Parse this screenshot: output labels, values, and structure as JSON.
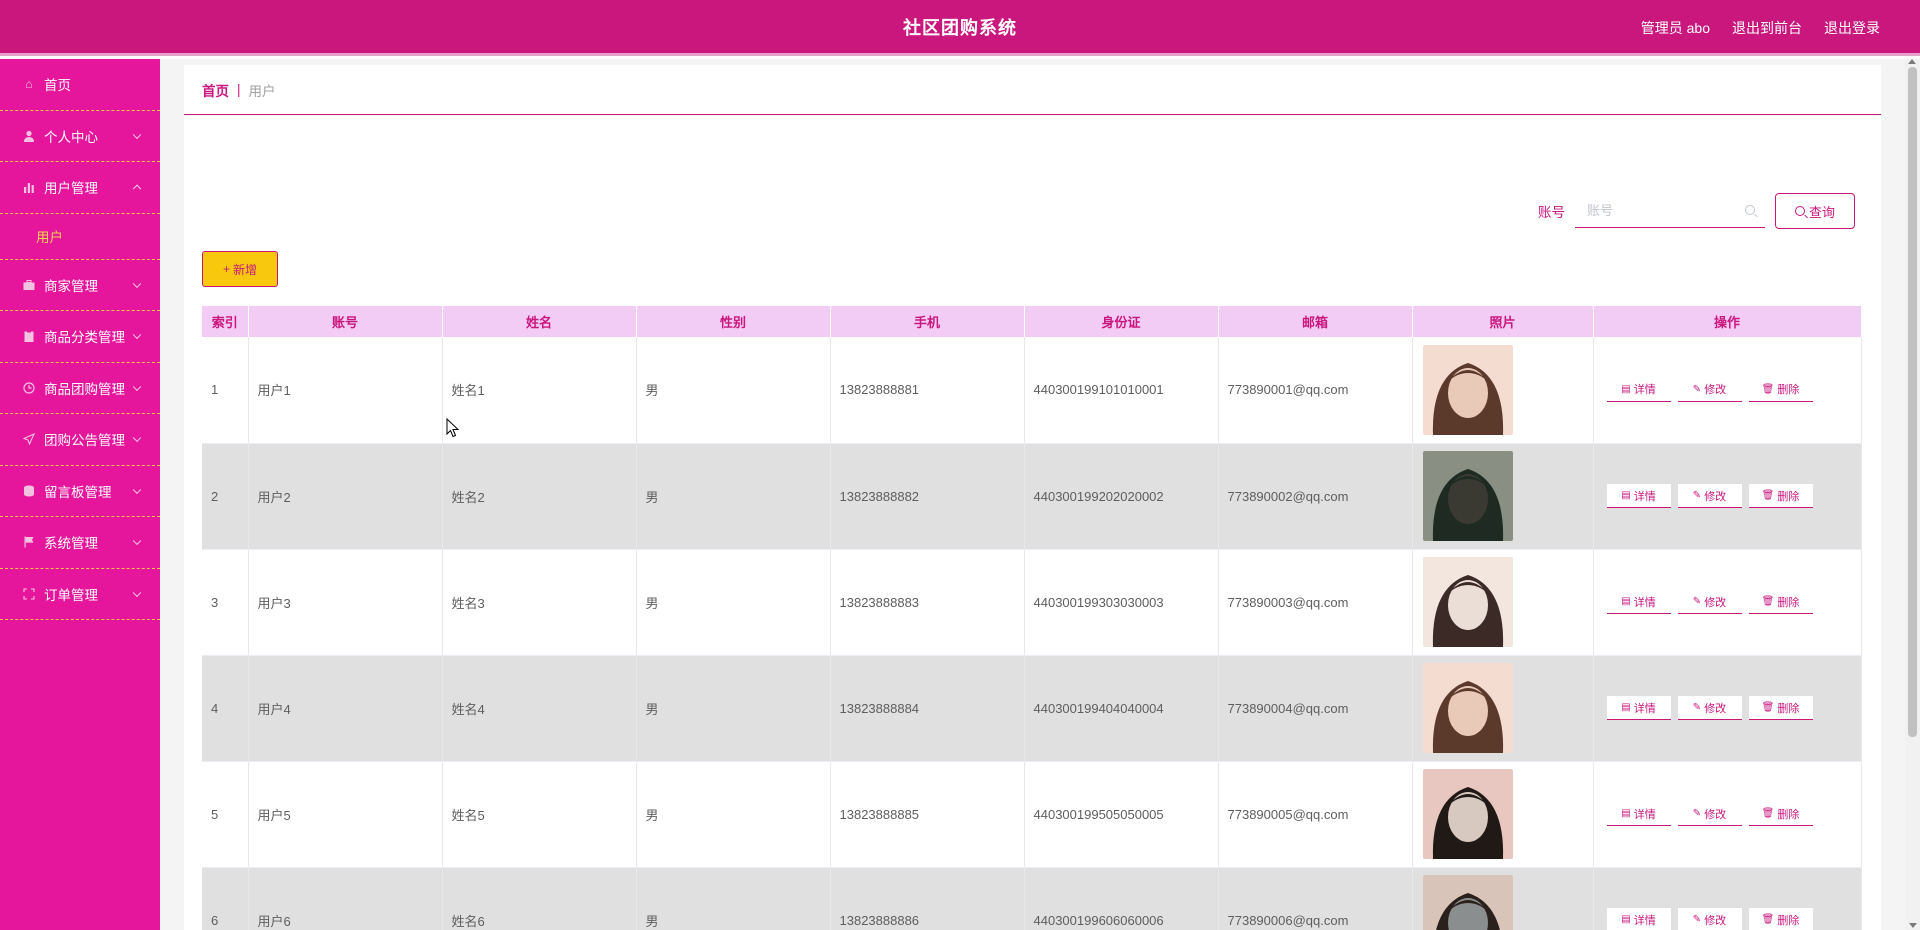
{
  "header": {
    "title": "社区团购系统",
    "admin": "管理员 abo",
    "to_front": "退出到前台",
    "logout": "退出登录"
  },
  "sidebar": {
    "items": [
      {
        "label": "首页",
        "icon": "home-icon"
      },
      {
        "label": "个人中心",
        "icon": "user-icon"
      },
      {
        "label": "用户管理",
        "icon": "chart-icon",
        "expanded": true
      },
      {
        "label": "商家管理",
        "icon": "briefcase-icon"
      },
      {
        "label": "商品分类管理",
        "icon": "clipboard-icon"
      },
      {
        "label": "商品团购管理",
        "icon": "clock-icon"
      },
      {
        "label": "团购公告管理",
        "icon": "send-icon"
      },
      {
        "label": "留言板管理",
        "icon": "database-icon"
      },
      {
        "label": "系统管理",
        "icon": "flag-icon"
      },
      {
        "label": "订单管理",
        "icon": "crop-icon"
      }
    ],
    "sub_active": "用户"
  },
  "breadcrumb": {
    "home": "首页",
    "separator": "|",
    "current": "用户"
  },
  "search": {
    "label": "账号",
    "placeholder": "账号",
    "query_label": "查询"
  },
  "actions": {
    "add_label": "新增"
  },
  "table": {
    "columns": [
      "索引",
      "账号",
      "姓名",
      "性别",
      "手机",
      "身份证",
      "邮箱",
      "照片",
      "操作"
    ],
    "op_labels": {
      "detail": "详情",
      "edit": "修改",
      "delete": "删除"
    },
    "rows": [
      {
        "index": "1",
        "account": "用户1",
        "name": "姓名1",
        "gender": "男",
        "phone": "13823888881",
        "id_card": "440300199101010001",
        "email": "773890001@qq.com"
      },
      {
        "index": "2",
        "account": "用户2",
        "name": "姓名2",
        "gender": "男",
        "phone": "13823888882",
        "id_card": "440300199202020002",
        "email": "773890002@qq.com"
      },
      {
        "index": "3",
        "account": "用户3",
        "name": "姓名3",
        "gender": "男",
        "phone": "13823888883",
        "id_card": "440300199303030003",
        "email": "773890003@qq.com"
      },
      {
        "index": "4",
        "account": "用户4",
        "name": "姓名4",
        "gender": "男",
        "phone": "13823888884",
        "id_card": "440300199404040004",
        "email": "773890004@qq.com"
      },
      {
        "index": "5",
        "account": "用户5",
        "name": "姓名5",
        "gender": "男",
        "phone": "13823888885",
        "id_card": "440300199505050005",
        "email": "773890005@qq.com"
      },
      {
        "index": "6",
        "account": "用户6",
        "name": "姓名6",
        "gender": "男",
        "phone": "13823888886",
        "id_card": "440300199606060006",
        "email": "773890006@qq.com"
      }
    ]
  },
  "colors": {
    "brand": "#c9177e",
    "sidebar": "#e5169b",
    "accent_yellow": "#f7c80e",
    "header_row": "#f3ccf5"
  }
}
